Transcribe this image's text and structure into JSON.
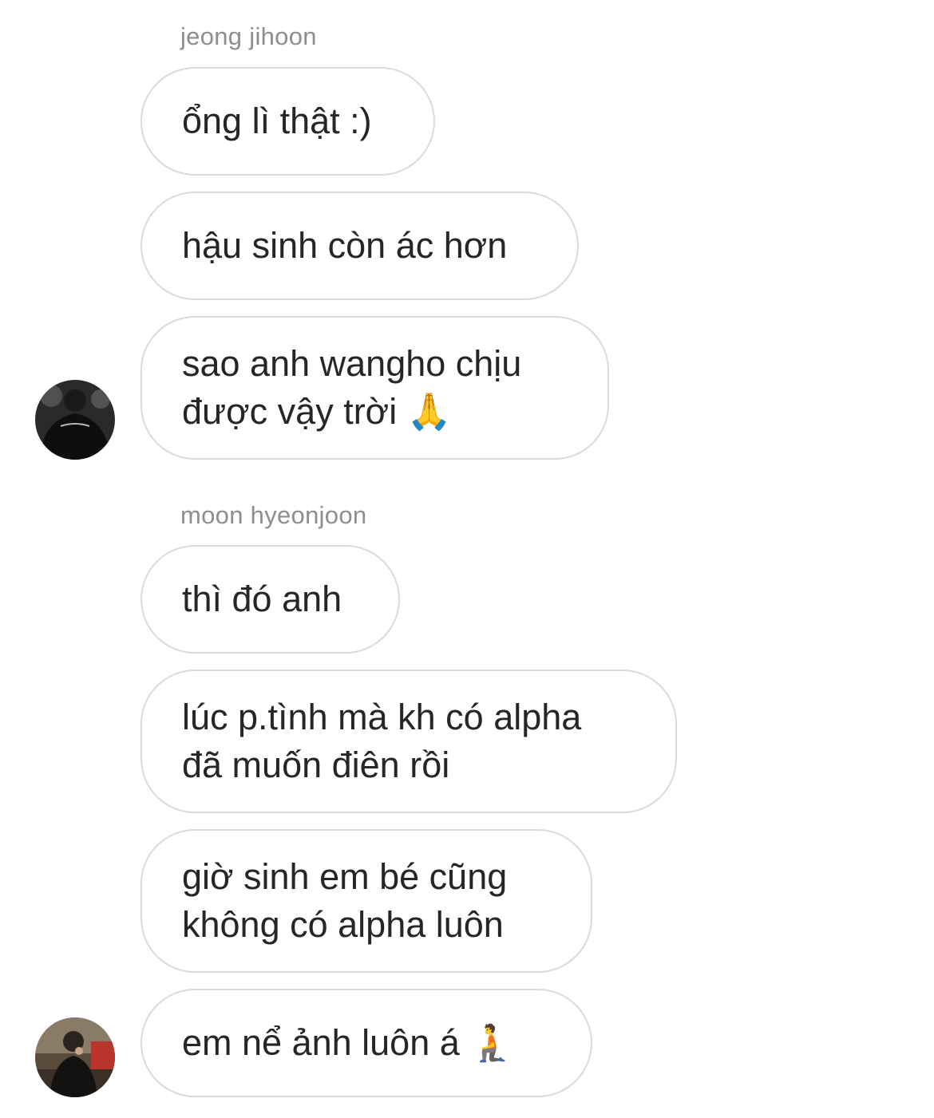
{
  "groups": [
    {
      "sender": "jeong jihoon",
      "messages": [
        "ổng lì thật :)",
        "hậu sinh còn ác hơn",
        "sao anh wangho chịu\nđược vậy trời 🙏"
      ],
      "avatar_icon": "person-in-black-jacket-avatar"
    },
    {
      "sender": "moon hyeonjoon",
      "messages": [
        "thì đó anh",
        "lúc p.tình mà kh có alpha\nđã muốn điên rồi",
        "giờ sinh em bé cũng\nkhông có alpha luôn",
        "em nể ảnh luôn á 🧎"
      ],
      "avatar_icon": "person-outdoors-avatar"
    }
  ],
  "colors": {
    "bubble_border": "#dbdbdb",
    "sender_text": "#8e8e8e",
    "message_text": "#262626",
    "background": "#ffffff"
  }
}
